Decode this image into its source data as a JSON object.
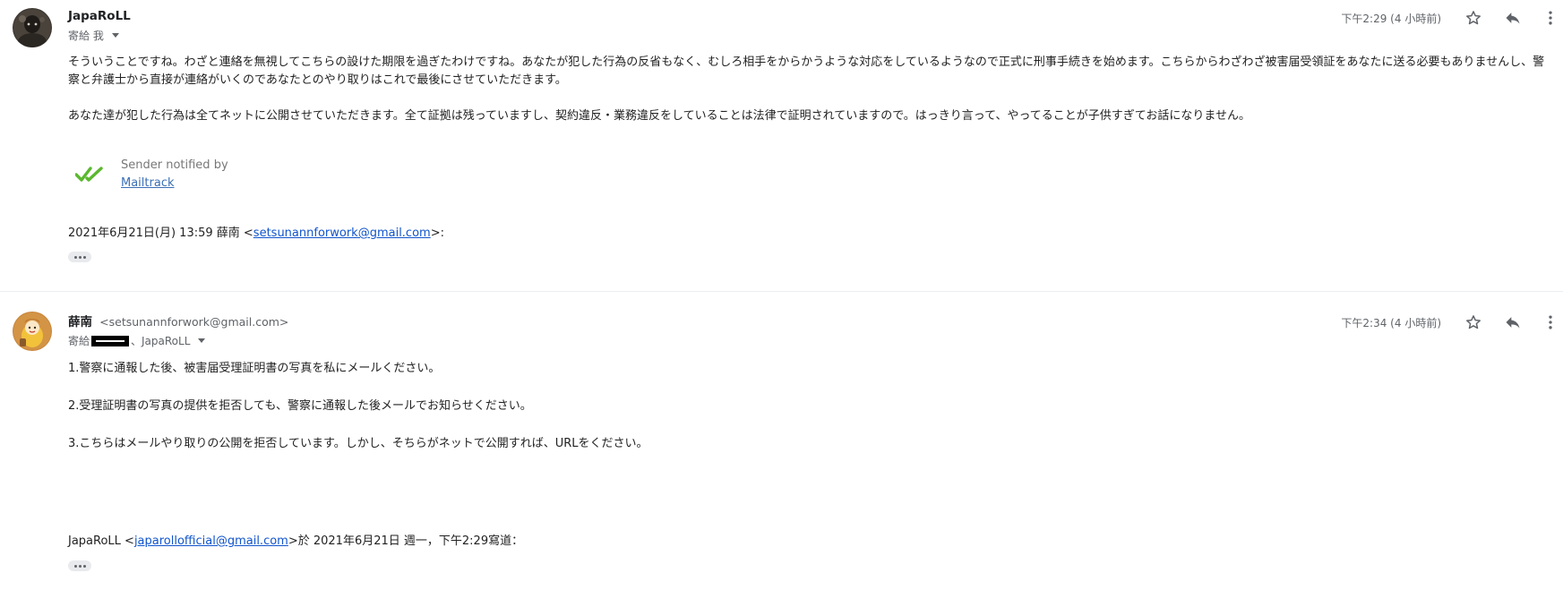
{
  "messages": [
    {
      "sender_name": "JapaRoLL",
      "sender_email": "",
      "to_label": "寄給 我",
      "time": "下午2:29 (4 小時前)",
      "body": [
        "そういうことですね。わざと連絡を無視してこちらの設けた期限を過ぎたわけですね。あなたが犯した行為の反省もなく、むしろ相手をからかうような対応をしているようなので正式に刑事手続きを始めます。こちらからわざわざ被害届受領証をあなたに送る必要もありませんし、警察と弁護士から直接が連絡がいくのであなたとのやり取りはこれで最後にさせていただきます。",
        "あなた達が犯した行為は全てネットに公開させていただきます。全て証拠は残っていますし、契約違反・業務違反をしていることは法律で証明されていますので。はっきり言って、やってることが子供すぎてお話になりません。"
      ],
      "mailtrack": {
        "line1": "Sender notified by",
        "link": "Mailtrack"
      },
      "quote": {
        "prefix": "2021年6月21日(月) 13:59 薛南 <",
        "email": "setsunannforwork@gmail.com",
        "suffix": ">:"
      }
    },
    {
      "sender_name": "薛南",
      "sender_email": "<setsunannforwork@gmail.com>",
      "to_prefix": "寄給",
      "to_suffix": "、JapaRoLL",
      "time": "下午2:34 (4 小時前)",
      "body": [
        "1.警察に通報した後、被害届受理証明書の写真を私にメールください。",
        "2.受理証明書の写真の提供を拒否しても、警察に通報した後メールでお知らせください。",
        "3.こちらはメールやり取りの公開を拒否しています。しかし、そちらがネットで公開すれば、URLをください。"
      ],
      "quote": {
        "prefix": "JapaRoLL <",
        "email": "japarollofficial@gmail.com",
        "suffix": ">於 2021年6月21日 週一，下午2:29寫道："
      }
    }
  ],
  "colors": {
    "link": "#1155cc",
    "mailtrack_check": "#5bb82e",
    "icon": "#5f6368"
  },
  "icons": [
    "avatar",
    "star-icon",
    "reply-icon",
    "more-vert-icon",
    "check-double-icon",
    "chevron-down-icon"
  ]
}
